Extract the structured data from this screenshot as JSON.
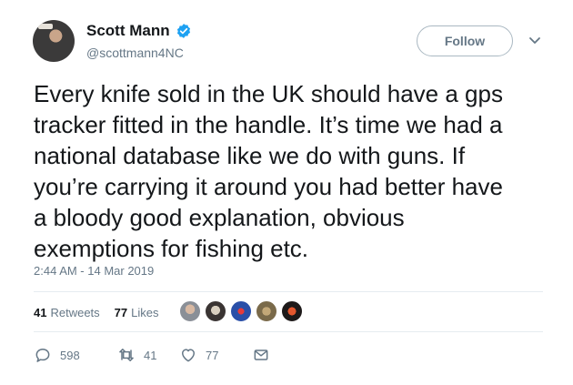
{
  "user": {
    "display_name": "Scott Mann",
    "handle": "@scottmann4NC",
    "verified": true
  },
  "follow_label": "Follow",
  "tweet": {
    "lines": [
      "Every knife sold in the UK should have a gps",
      "tracker fitted in the handle. It’s time we had a",
      "national database like we do with guns. If",
      "you’re carrying it around you had better have",
      "a bloody good explanation, obvious",
      "exemptions for fishing etc."
    ]
  },
  "timestamp": "2:44 AM - 14 Mar 2019",
  "stats": {
    "retweets_count": "41",
    "retweets_label": "Retweets",
    "likes_count": "77",
    "likes_label": "Likes"
  },
  "likers": [
    {
      "icon": "avatar-1",
      "color": "#8a8f97"
    },
    {
      "icon": "avatar-2",
      "color": "#3a3433"
    },
    {
      "icon": "avatar-3",
      "color": "#2a4fa8"
    },
    {
      "icon": "avatar-4",
      "color": "#7a6a4a"
    },
    {
      "icon": "avatar-5",
      "color": "#1e1a1a"
    }
  ],
  "actions": {
    "reply_count": "598",
    "retweet_count": "41",
    "like_count": "77"
  },
  "colors": {
    "verified_blue": "#1da1f2",
    "muted_text": "#657786",
    "divider": "#e6ecf0"
  }
}
